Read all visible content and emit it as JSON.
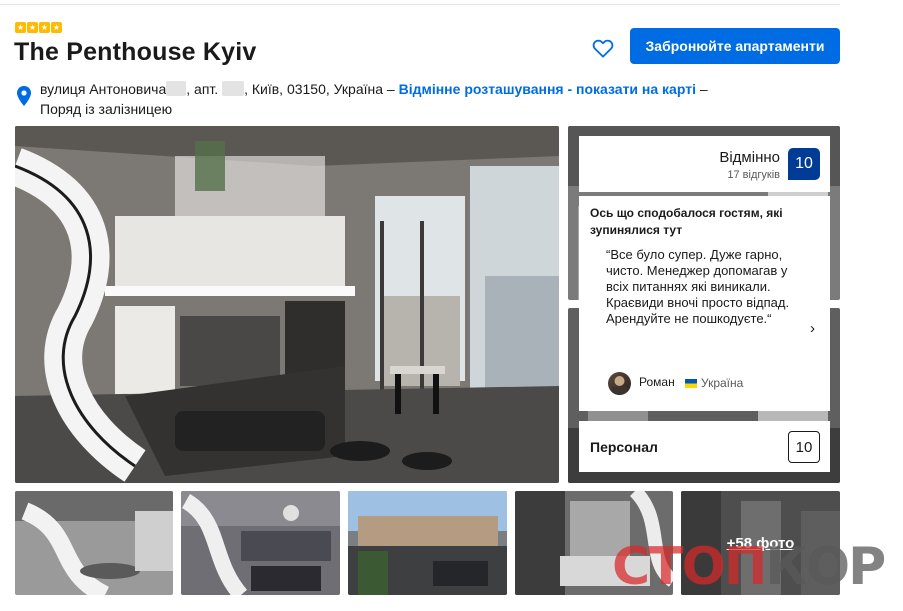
{
  "hotel": {
    "stars": 4,
    "name": "The Penthouse Kyiv",
    "book_button": "Забронюйте апартаменти"
  },
  "address": {
    "part1": "вулиця Антоновича",
    "part2": ", апт. ",
    "part3": ", Київ, 03150, Україна – ",
    "location_link": "Відмінне розташування",
    "map_link": " - показати на карті",
    "dash": " –",
    "near": "Поряд із залізницею"
  },
  "rating": {
    "word": "Відмінно",
    "count": "17 відгуків",
    "score": "10"
  },
  "review": {
    "heading": "Ось що сподобалося гостям, які зупинялися тут",
    "text": "“Все було супер. Дуже гарно, чисто. Менеджер допомагав у всіх питаннях які виникали. Краєвиди вночі просто відпад. Арендуйте не пошкодуєте.“",
    "reviewer": "Роман",
    "country": "Україна",
    "next_icon": "chevron-right-icon"
  },
  "staff": {
    "label": "Персонал",
    "score": "10"
  },
  "gallery": {
    "more_label": "+58 фото"
  },
  "watermark": {
    "part1": "СТОП",
    "part2": "КОР"
  },
  "colors": {
    "primary": "#006ce4",
    "score_badge": "#003b95",
    "star": "#febb02"
  }
}
